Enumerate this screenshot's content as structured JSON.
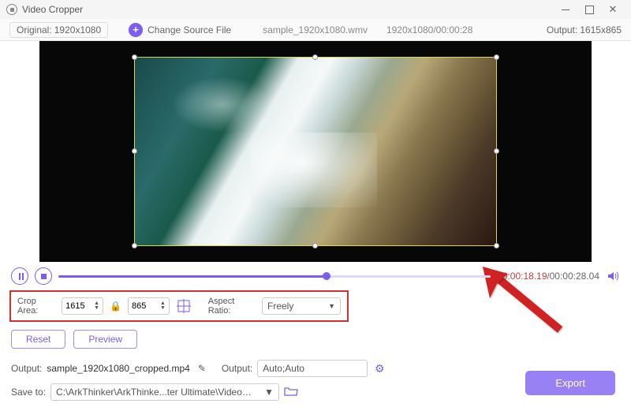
{
  "title": "Video Cropper",
  "toolbar": {
    "original_label": "Original:",
    "original_dims": "1920x1080",
    "change_source": "Change Source File",
    "sample_name": "sample_1920x1080.wmv",
    "source_dims_time": "1920x1080/00:00:28",
    "output_label": "Output:",
    "output_dims": "1615x865"
  },
  "timeline": {
    "elapsed": "00:00:18.19",
    "total": "00:00:28.04"
  },
  "crop": {
    "label": "Crop Area:",
    "width": "1615",
    "height": "865",
    "aspect_label": "Aspect Ratio:",
    "aspect_value": "Freely"
  },
  "buttons": {
    "reset": "Reset",
    "preview": "Preview",
    "export": "Export"
  },
  "output_row": {
    "label": "Output:",
    "filename": "sample_1920x1080_cropped.mp4",
    "label2": "Output:",
    "auto": "Auto;Auto"
  },
  "save": {
    "label": "Save to:",
    "path": "C:\\ArkThinker\\ArkThinke...ter Ultimate\\Video Crop"
  }
}
